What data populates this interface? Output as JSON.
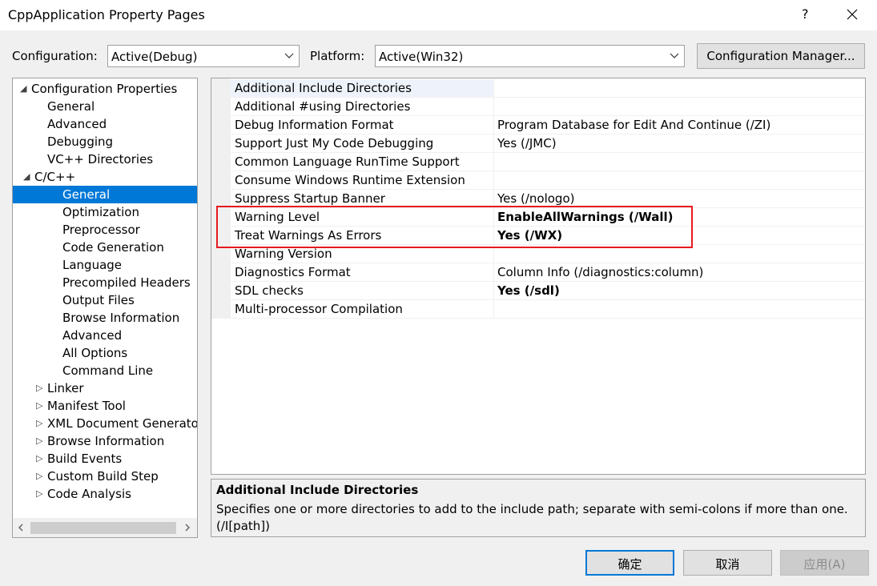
{
  "window": {
    "title": "CppApplication Property Pages",
    "help": "?"
  },
  "toolbar": {
    "configuration_label": "Configuration:",
    "configuration_value": "Active(Debug)",
    "platform_label": "Platform:",
    "platform_value": "Active(Win32)",
    "config_manager_label": "Configuration Manager..."
  },
  "tree": [
    {
      "label": "Configuration Properties",
      "twisty": "expanded"
    },
    {
      "label": "General"
    },
    {
      "label": "Advanced"
    },
    {
      "label": "Debugging"
    },
    {
      "label": "VC++ Directories"
    },
    {
      "label": "C/C++",
      "twisty": "expanded"
    },
    {
      "label": "General",
      "selected": true
    },
    {
      "label": "Optimization"
    },
    {
      "label": "Preprocessor"
    },
    {
      "label": "Code Generation"
    },
    {
      "label": "Language"
    },
    {
      "label": "Precompiled Headers"
    },
    {
      "label": "Output Files"
    },
    {
      "label": "Browse Information"
    },
    {
      "label": "Advanced"
    },
    {
      "label": "All Options"
    },
    {
      "label": "Command Line"
    },
    {
      "label": "Linker",
      "twisty": "collapsed"
    },
    {
      "label": "Manifest Tool",
      "twisty": "collapsed"
    },
    {
      "label": "XML Document Generato",
      "twisty": "collapsed"
    },
    {
      "label": "Browse Information",
      "twisty": "collapsed"
    },
    {
      "label": "Build Events",
      "twisty": "collapsed"
    },
    {
      "label": "Custom Build Step",
      "twisty": "collapsed"
    },
    {
      "label": "Code Analysis",
      "twisty": "collapsed"
    }
  ],
  "properties": [
    {
      "name": "Additional Include Directories",
      "value": ""
    },
    {
      "name": "Additional #using Directories",
      "value": ""
    },
    {
      "name": "Debug Information Format",
      "value": "Program Database for Edit And Continue (/ZI)"
    },
    {
      "name": "Support Just My Code Debugging",
      "value": "Yes (/JMC)"
    },
    {
      "name": "Common Language RunTime Support",
      "value": ""
    },
    {
      "name": "Consume Windows Runtime Extension",
      "value": ""
    },
    {
      "name": "Suppress Startup Banner",
      "value": "Yes (/nologo)"
    },
    {
      "name": "Warning Level",
      "value": "EnableAllWarnings (/Wall)",
      "bold": true
    },
    {
      "name": "Treat Warnings As Errors",
      "value": "Yes (/WX)",
      "bold": true
    },
    {
      "name": "Warning Version",
      "value": ""
    },
    {
      "name": "Diagnostics Format",
      "value": "Column Info (/diagnostics:column)"
    },
    {
      "name": "SDL checks",
      "value": "Yes (/sdl)",
      "bold": true
    },
    {
      "name": "Multi-processor Compilation",
      "value": ""
    }
  ],
  "description": {
    "title": "Additional Include Directories",
    "text": "Specifies one or more directories to add to the include path; separate with semi-colons if more than one. (/I[path])"
  },
  "buttons": {
    "ok": "确定",
    "cancel": "取消",
    "apply": "应用(A)"
  },
  "colors": {
    "selection": "#0078d7",
    "highlight_box": "#e8191f"
  }
}
